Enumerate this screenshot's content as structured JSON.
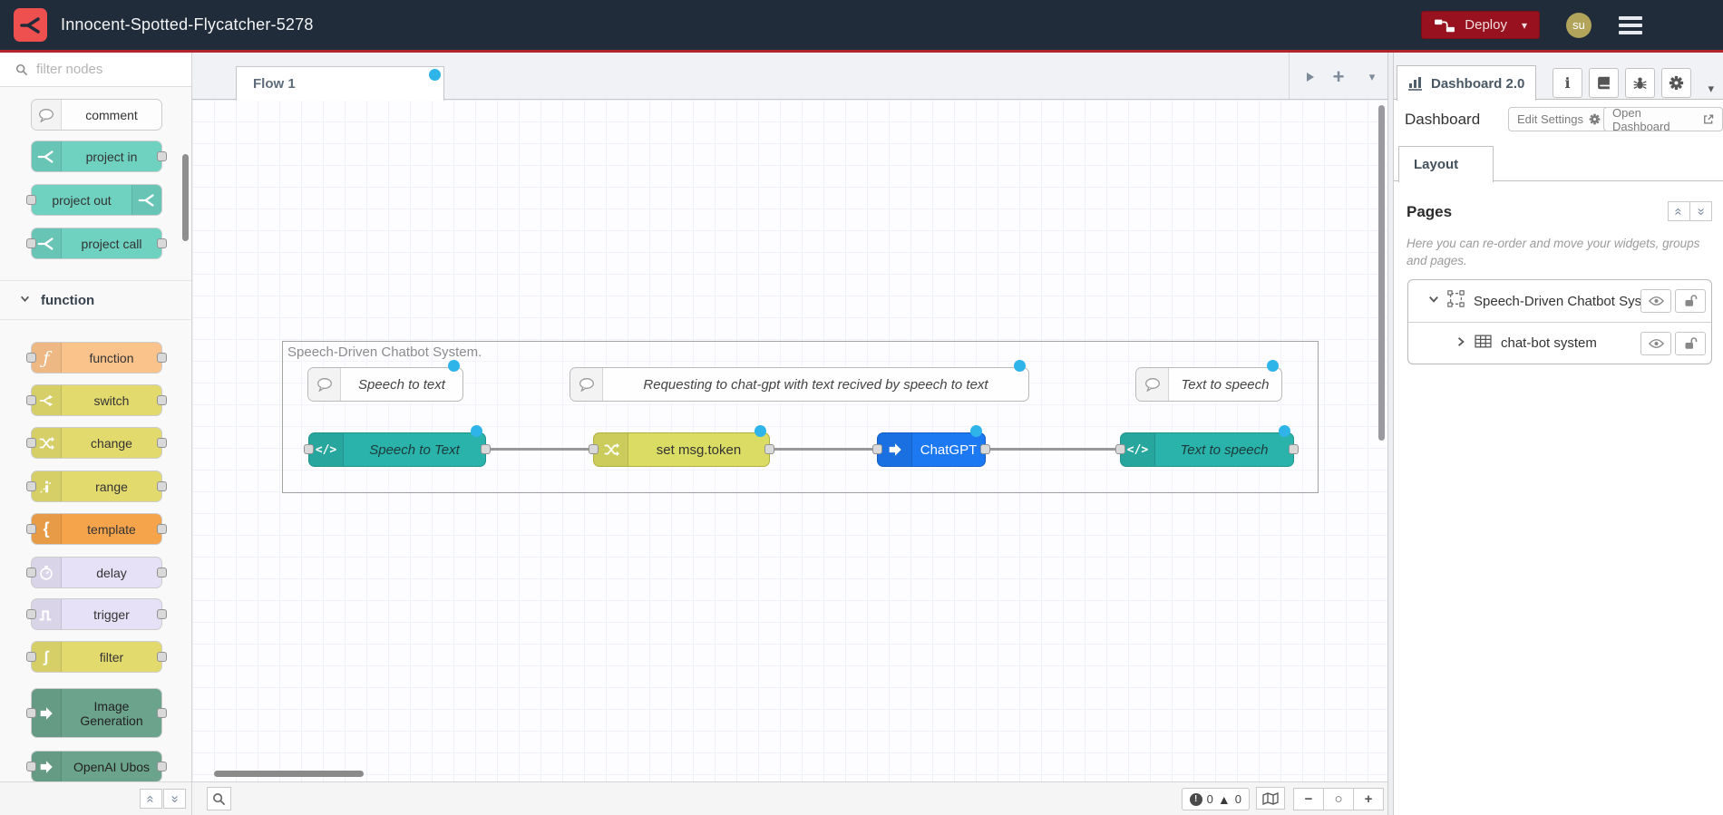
{
  "header": {
    "title": "Innocent-Spotted-Flycatcher-5278",
    "deploy_label": "Deploy",
    "avatar_initials": "su"
  },
  "colors": {
    "header_bg": "#212c3a",
    "accent_line": "#b2252e",
    "deploy_red": "#97121e",
    "brand_red": "#ee4f4f",
    "changed_dot": "#2eb4e9",
    "project_node": "#6fd1c0",
    "function_node": "#fbc38c",
    "olive_node": "#e3da6e",
    "template_node": "#f5a44c",
    "lavender_node": "#e7e1f7",
    "sage_node": "#6ba38d",
    "teal_node": "#2ab3aa",
    "blue_node": "#1d79f2",
    "canvas_olive_node": "#dbdc64"
  },
  "palette": {
    "search_placeholder": "filter nodes",
    "items": [
      {
        "label": "comment"
      },
      {
        "label": "project in"
      },
      {
        "label": "project out"
      },
      {
        "label": "project call"
      }
    ],
    "category_label": "function",
    "function_items": [
      {
        "label": "function"
      },
      {
        "label": "switch"
      },
      {
        "label": "change"
      },
      {
        "label": "range"
      },
      {
        "label": "template"
      },
      {
        "label": "delay"
      },
      {
        "label": "trigger"
      },
      {
        "label": "filter"
      },
      {
        "label": "Image Generation"
      },
      {
        "label": "OpenAI Ubos"
      }
    ]
  },
  "workspace": {
    "tab_label": "Flow 1",
    "group_label": "Speech-Driven Chatbot System.",
    "comments": [
      {
        "label": "Speech to text"
      },
      {
        "label": "Requesting to chat-gpt with text recived by speech to text"
      },
      {
        "label": "Text to speech"
      }
    ],
    "nodes": [
      {
        "label": "Speech to Text"
      },
      {
        "label": "set msg.token"
      },
      {
        "label": "ChatGPT"
      },
      {
        "label": "Text to speech"
      }
    ],
    "footer": {
      "error_count": "0",
      "warning_count": "0"
    }
  },
  "sidebar": {
    "tab_label": "Dashboard 2.0",
    "section_title": "Dashboard",
    "edit_settings_label": "Edit Settings",
    "open_dashboard_label": "Open Dashboard",
    "layout_tab_label": "Layout",
    "pages_title": "Pages",
    "pages_help": "Here you can re-order and move your widgets, groups and pages.",
    "rows": [
      {
        "label": "Speech-Driven Chatbot System"
      },
      {
        "label": "chat-bot system"
      }
    ]
  }
}
